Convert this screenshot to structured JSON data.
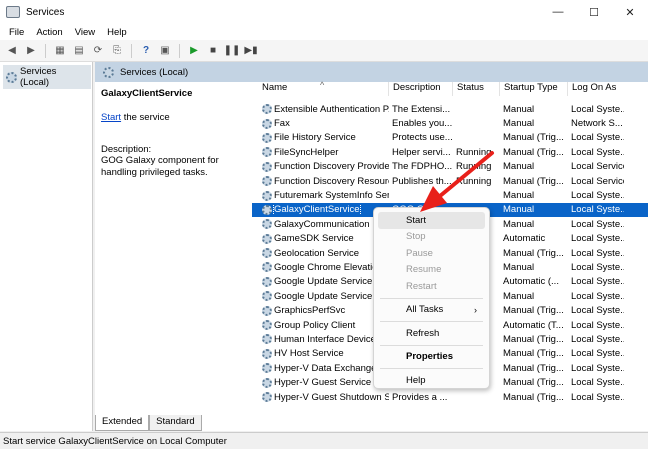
{
  "window": {
    "title": "Services",
    "minimize": "—",
    "maximize": "☐",
    "close": "✕"
  },
  "menu": [
    "File",
    "Action",
    "View",
    "Help"
  ],
  "tree": {
    "root_label": "Services (Local)"
  },
  "pane": {
    "header": "Services (Local)",
    "selected_name": "GalaxyClientService",
    "start_link": "Start",
    "start_suffix": " the service",
    "desc_label": "Description:",
    "desc_text": "GOG Galaxy component for handling privileged tasks."
  },
  "columns": [
    "Name",
    "Description",
    "Status",
    "Startup Type",
    "Log On As"
  ],
  "rows": [
    {
      "name": "Extensible Authentication P...",
      "desc": "The Extensi...",
      "status": "",
      "type": "Manual",
      "logon": "Local Syste..."
    },
    {
      "name": "Fax",
      "desc": "Enables you...",
      "status": "",
      "type": "Manual",
      "logon": "Network S..."
    },
    {
      "name": "File History Service",
      "desc": "Protects use...",
      "status": "",
      "type": "Manual (Trig...",
      "logon": "Local Syste..."
    },
    {
      "name": "FileSyncHelper",
      "desc": "Helper servi...",
      "status": "Running",
      "type": "Manual (Trig...",
      "logon": "Local Syste..."
    },
    {
      "name": "Function Discovery Provide...",
      "desc": "The FDPHO...",
      "status": "Running",
      "type": "Manual",
      "logon": "Local Service"
    },
    {
      "name": "Function Discovery Resourc...",
      "desc": "Publishes th...",
      "status": "Running",
      "type": "Manual (Trig...",
      "logon": "Local Service"
    },
    {
      "name": "Futuremark SystemInfo Ser...",
      "desc": "",
      "status": "",
      "type": "Manual",
      "logon": "Local Syste..."
    },
    {
      "name": "GalaxyClientService",
      "desc": "GOG Galax...",
      "status": "",
      "type": "Manual",
      "logon": "Local Syste..."
    },
    {
      "name": "GalaxyCommunication",
      "desc": "",
      "status": "",
      "type": "Manual",
      "logon": "Local Syste..."
    },
    {
      "name": "GameSDK Service",
      "desc": "",
      "status": "",
      "type": "Automatic",
      "logon": "Local Syste..."
    },
    {
      "name": "Geolocation Service",
      "desc": "",
      "status": "",
      "type": "Manual (Trig...",
      "logon": "Local Syste..."
    },
    {
      "name": "Google Chrome Elevation",
      "desc": "",
      "status": "",
      "type": "Manual",
      "logon": "Local Syste..."
    },
    {
      "name": "Google Update Service (g",
      "desc": "",
      "status": "",
      "type": "Automatic (...",
      "logon": "Local Syste..."
    },
    {
      "name": "Google Update Service (g",
      "desc": "",
      "status": "",
      "type": "Manual",
      "logon": "Local Syste..."
    },
    {
      "name": "GraphicsPerfSvc",
      "desc": "",
      "status": "",
      "type": "Manual (Trig...",
      "logon": "Local Syste..."
    },
    {
      "name": "Group Policy Client",
      "desc": "",
      "status": "",
      "type": "Automatic (T...",
      "logon": "Local Syste..."
    },
    {
      "name": "Human Interface Device",
      "desc": "",
      "status": "",
      "type": "Manual (Trig...",
      "logon": "Local Syste..."
    },
    {
      "name": "HV Host Service",
      "desc": "",
      "status": "",
      "type": "Manual (Trig...",
      "logon": "Local Syste..."
    },
    {
      "name": "Hyper-V Data Exchange S",
      "desc": "",
      "status": "",
      "type": "Manual (Trig...",
      "logon": "Local Syste..."
    },
    {
      "name": "Hyper-V Guest Service In",
      "desc": "",
      "status": "",
      "type": "Manual (Trig...",
      "logon": "Local Syste..."
    },
    {
      "name": "Hyper-V Guest Shutdown S...",
      "desc": "Provides a ...",
      "status": "",
      "type": "Manual (Trig...",
      "logon": "Local Syste..."
    }
  ],
  "context_menu": {
    "start": "Start",
    "stop": "Stop",
    "pause": "Pause",
    "resume": "Resume",
    "restart": "Restart",
    "all_tasks": "All Tasks",
    "refresh": "Refresh",
    "properties": "Properties",
    "help": "Help"
  },
  "tabs": {
    "extended": "Extended",
    "standard": "Standard"
  },
  "statusbar": "Start service GalaxyClientService on Local Computer",
  "colors": {
    "selection": "#0a64c8",
    "header": "#c3d3e3",
    "arrow": "#e8201a"
  }
}
